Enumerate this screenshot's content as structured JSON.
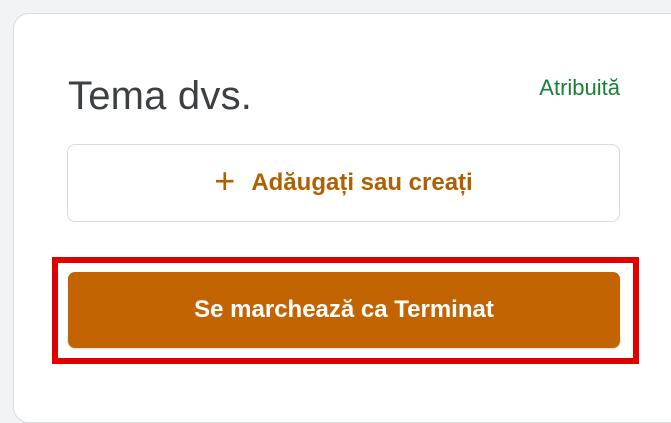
{
  "card": {
    "title": "Tema dvs.",
    "status": "Atribuită"
  },
  "actions": {
    "add_icon": "plus-icon",
    "add_symbol": "+",
    "add_label": "Adăugați sau creați",
    "mark_done_label": "Se marchează ca Terminat"
  },
  "colors": {
    "accent": "#c26401",
    "accent_text": "#b06000",
    "status": "#188038",
    "highlight": "#e00000"
  }
}
